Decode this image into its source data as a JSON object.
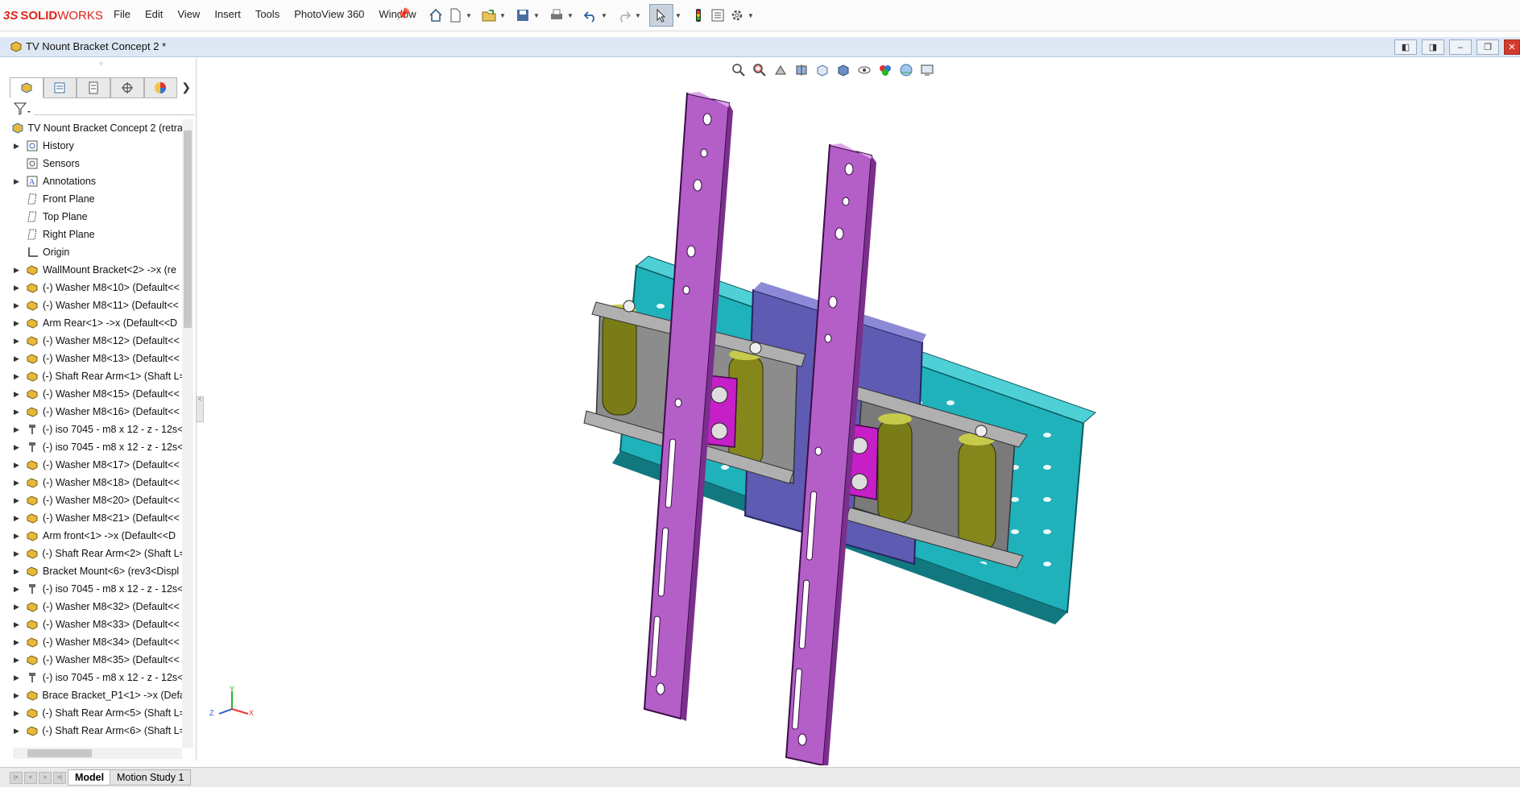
{
  "app": {
    "logo_ds": "3S",
    "logo_brand_bold": "SOLID",
    "logo_brand_light": "WORKS"
  },
  "menus": [
    "File",
    "Edit",
    "View",
    "Insert",
    "Tools",
    "PhotoView 360",
    "Window"
  ],
  "document": {
    "title": "TV Nount Bracket Concept 2 *"
  },
  "tree": {
    "root": "TV Nount Bracket Concept 2  (retrac",
    "items": [
      {
        "label": "History",
        "icon": "history-icon",
        "expandable": true
      },
      {
        "label": "Sensors",
        "icon": "sensor-icon",
        "expandable": false
      },
      {
        "label": "Annotations",
        "icon": "annotation-icon",
        "expandable": true
      },
      {
        "label": "Front Plane",
        "icon": "plane-icon",
        "expandable": false
      },
      {
        "label": "Top Plane",
        "icon": "plane-icon",
        "expandable": false
      },
      {
        "label": "Right Plane",
        "icon": "plane-icon",
        "expandable": false
      },
      {
        "label": "Origin",
        "icon": "origin-icon",
        "expandable": false
      },
      {
        "label": "WallMount Bracket<2> ->x (re",
        "icon": "part-icon",
        "expandable": true
      },
      {
        "label": "(-) Washer M8<10> (Default<<",
        "icon": "part-icon",
        "expandable": true
      },
      {
        "label": "(-) Washer M8<11> (Default<<",
        "icon": "part-icon",
        "expandable": true
      },
      {
        "label": "Arm Rear<1> ->x (Default<<D",
        "icon": "part-icon",
        "expandable": true
      },
      {
        "label": "(-) Washer M8<12> (Default<<",
        "icon": "part-icon",
        "expandable": true
      },
      {
        "label": "(-) Washer M8<13> (Default<<",
        "icon": "part-icon",
        "expandable": true
      },
      {
        "label": "(-) Shaft Rear Arm<1> (Shaft L=",
        "icon": "part-icon",
        "expandable": true
      },
      {
        "label": "(-) Washer M8<15> (Default<<",
        "icon": "part-icon",
        "expandable": true
      },
      {
        "label": "(-) Washer M8<16> (Default<<",
        "icon": "part-icon",
        "expandable": true
      },
      {
        "label": "(-) iso 7045 - m8 x 12 - z - 12s<",
        "icon": "screw-icon",
        "expandable": true
      },
      {
        "label": "(-) iso 7045 - m8 x 12 - z - 12s<",
        "icon": "screw-icon",
        "expandable": true
      },
      {
        "label": "(-) Washer M8<17> (Default<<",
        "icon": "part-icon",
        "expandable": true
      },
      {
        "label": "(-) Washer M8<18> (Default<<",
        "icon": "part-icon",
        "expandable": true
      },
      {
        "label": "(-) Washer M8<20> (Default<<",
        "icon": "part-icon",
        "expandable": true
      },
      {
        "label": "(-) Washer M8<21> (Default<<",
        "icon": "part-icon",
        "expandable": true
      },
      {
        "label": "Arm front<1> ->x (Default<<D",
        "icon": "part-icon",
        "expandable": true
      },
      {
        "label": "(-) Shaft Rear Arm<2> (Shaft L=",
        "icon": "part-icon",
        "expandable": true
      },
      {
        "label": "Bracket Mount<6> (rev3<Displ",
        "icon": "part-icon",
        "expandable": true
      },
      {
        "label": "(-) iso 7045 - m8 x 12 - z - 12s<",
        "icon": "screw-icon",
        "expandable": true
      },
      {
        "label": "(-) Washer M8<32> (Default<<",
        "icon": "part-icon",
        "expandable": true
      },
      {
        "label": "(-) Washer M8<33> (Default<<",
        "icon": "part-icon",
        "expandable": true
      },
      {
        "label": "(-) Washer M8<34> (Default<<",
        "icon": "part-icon",
        "expandable": true
      },
      {
        "label": "(-) Washer M8<35> (Default<<",
        "icon": "part-icon",
        "expandable": true
      },
      {
        "label": "(-) iso 7045 - m8 x 12 - z - 12s<",
        "icon": "screw-icon",
        "expandable": true
      },
      {
        "label": "Brace Bracket_P1<1> ->x (Defa",
        "icon": "part-icon",
        "expandable": true
      },
      {
        "label": "(-) Shaft Rear Arm<5> (Shaft L=",
        "icon": "part-icon",
        "expandable": true
      },
      {
        "label": "(-) Shaft Rear Arm<6> (Shaft L=",
        "icon": "part-icon",
        "expandable": true
      }
    ]
  },
  "bottom_tabs": {
    "model": "Model",
    "motion": "Motion Study 1"
  },
  "triad": {
    "x": "X",
    "y": "Y",
    "z": "Z"
  },
  "colors": {
    "accent": "#e2231a",
    "purple": "#b05bc4",
    "magenta": "#c722c9",
    "teal": "#21a8b2",
    "indigo": "#5d5ab0",
    "olive": "#7a7c16"
  }
}
